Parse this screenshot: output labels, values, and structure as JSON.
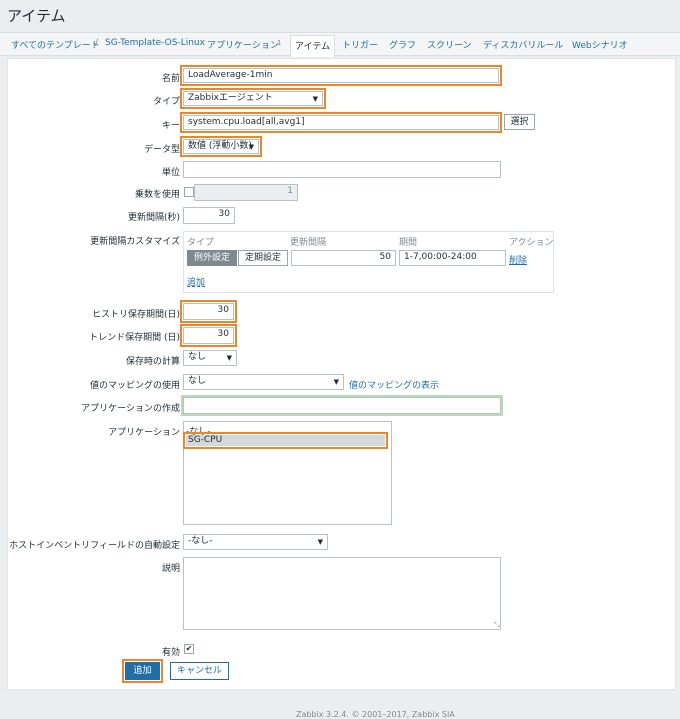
{
  "page": {
    "title": "アイテム"
  },
  "nav": {
    "items": [
      "すべてのテンプレート",
      "/",
      "SG-Template-OS-Linux",
      "アプリケーション",
      "1",
      "アイテム",
      "トリガー",
      "グラフ",
      "スクリーン",
      "ディスカバリルール",
      "Webシナリオ"
    ]
  },
  "form": {
    "name": {
      "label": "名前",
      "value": "LoadAverage-1min"
    },
    "type": {
      "label": "タイプ",
      "value": "Zabbixエージェント"
    },
    "key": {
      "label": "キー",
      "value": "system.cpu.load[all,avg1]",
      "button": "選択"
    },
    "data_type": {
      "label": "データ型",
      "value": "数値 (浮動小数)"
    },
    "unit": {
      "label": "単位",
      "value": ""
    },
    "multiplier": {
      "label": "乗数を使用",
      "value": "1"
    },
    "interval": {
      "label": "更新間隔(秒)",
      "value": "30"
    },
    "custom_interval": {
      "label": "更新間隔カスタマイズ",
      "headers": [
        "タイプ",
        "更新間隔",
        "期間",
        "アクション"
      ],
      "row": {
        "tab1": "例外設定",
        "tab2": "定期設定",
        "interval": "50",
        "period": "1-7,00:00-24:00",
        "remove": "削除"
      },
      "add": "追加"
    },
    "history": {
      "label": "ヒストリ保存期間(日)",
      "value": "30"
    },
    "trends": {
      "label": "トレンド保存期間 (日)",
      "value": "30"
    },
    "store_value": {
      "label": "保存時の計算",
      "value": "なし"
    },
    "value_mapping": {
      "label": "値のマッピングの使用",
      "value": "なし",
      "link": "値のマッピングの表示"
    },
    "new_application": {
      "label": "アプリケーションの作成",
      "value": ""
    },
    "applications": {
      "label": "アプリケーション",
      "options": [
        "-なし-",
        "SG-CPU"
      ]
    },
    "inventory": {
      "label": "ホストインベントリフィールドの自動設定",
      "value": "-なし-"
    },
    "description": {
      "label": "説明",
      "value": ""
    },
    "enabled": {
      "label": "有効",
      "check": "✔"
    },
    "buttons": {
      "add": "追加",
      "cancel": "キャンセル"
    }
  },
  "footer": {
    "text": "Zabbix 3.2.4. © 2001–2017, Zabbix SIA"
  },
  "colors": {
    "highlight": "#e8872b",
    "primary": "#1f6ea8",
    "link": "#1f6ea8"
  }
}
